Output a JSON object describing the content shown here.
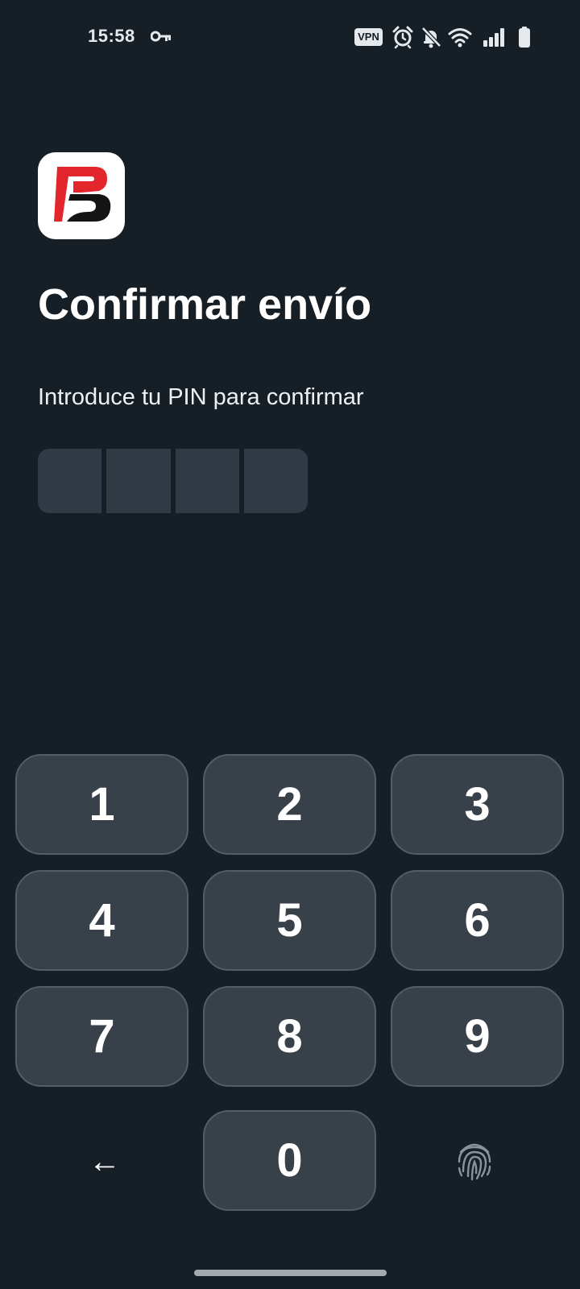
{
  "status_bar": {
    "time": "15:58",
    "vpn_label": "VPN",
    "icons": [
      "key-icon",
      "alarm-icon",
      "notifications-off-icon",
      "wifi-icon",
      "signal-icon",
      "battery-icon"
    ]
  },
  "app_icon": "brand-logo",
  "title": "Confirmar envío",
  "subtitle": "Introduce tu PIN para confirmar",
  "pin": {
    "length": 4,
    "entered": ""
  },
  "keypad": {
    "keys": [
      "1",
      "2",
      "3",
      "4",
      "5",
      "6",
      "7",
      "8",
      "9",
      "0"
    ],
    "backspace": "←",
    "fingerprint_icon": "fingerprint-icon"
  },
  "colors": {
    "background": "#161e26",
    "key_fill": "#38414a",
    "key_border": "#545d66",
    "pin_box": "#313b45",
    "brand_red": "#e3262b",
    "brand_black": "#141414"
  }
}
